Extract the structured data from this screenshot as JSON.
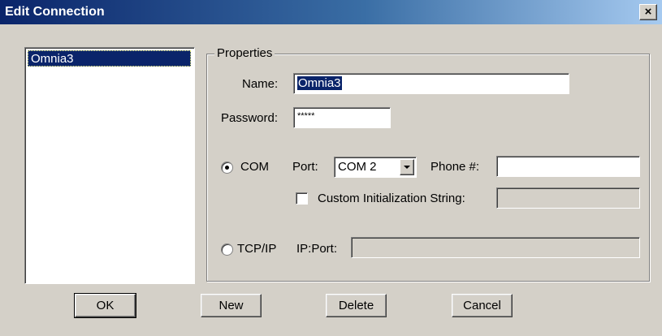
{
  "window": {
    "title": "Edit Connection",
    "close_glyph": "×"
  },
  "connections_list": {
    "items": [
      "Omnia3"
    ],
    "selected_index": 0
  },
  "properties": {
    "group_label": "Properties",
    "name_label": "Name:",
    "name_value": "Omnia3",
    "password_label": "Password:",
    "password_value": "*****",
    "com": {
      "label": "COM",
      "selected": true,
      "port_label": "Port:",
      "port_value": "COM 2",
      "phone_label": "Phone #:",
      "phone_value": "",
      "custom_init_label": "Custom Initialization String:",
      "custom_init_checked": false,
      "custom_init_value": ""
    },
    "tcpip": {
      "label": "TCP/IP",
      "selected": false,
      "ipport_label": "IP:Port:",
      "ipport_value": ""
    }
  },
  "buttons": {
    "ok": "OK",
    "new": "New",
    "delete": "Delete",
    "cancel": "Cancel"
  }
}
